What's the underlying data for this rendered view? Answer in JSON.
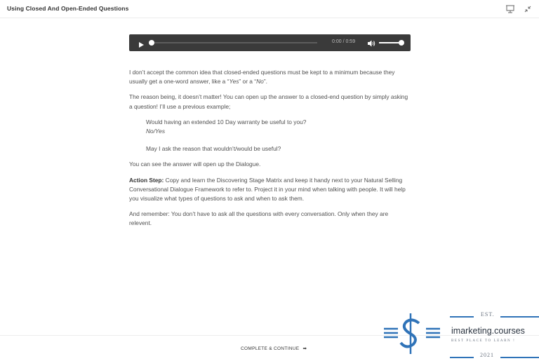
{
  "header": {
    "title": "Using Closed And Open-Ended Questions",
    "icons": [
      "presentation-icon",
      "minimize-icon"
    ]
  },
  "audio_player": {
    "time": "0:00 / 0:59",
    "progress": 0.0,
    "volume": 1.0,
    "icons": [
      "play-icon",
      "volume-icon"
    ]
  },
  "body": {
    "p1": "I don’t accept the common idea that closed-ended questions must be kept to a minimum because they usually get a one-word answer, like a “",
    "p1_yes": "Yes",
    "p1_mid": "” or a “",
    "p1_no": "No",
    "p1_end": "”.",
    "p2": "The reason being, it doesn’t matter! You can open up the answer to a closed-end question by simply asking a question! I’ll use a previous example;",
    "question": "Would having an extended 10 Day warranty be useful to you?",
    "answer": "No/Yes",
    "followup": "May I ask the reason that wouldn’t/would be useful?",
    "p3": "You can see the answer will open up the Dialogue.",
    "action_label": "Action Step:",
    "action_text": " Copy and learn the Discovering Stage Matrix and keep it handy next to your Natural Selling Conversational Dialogue Framework to refer to. Project it in your mind when talking with people. It will help you visualize what types of questions to ask and when to ask them.",
    "p5": "And remember: You don’t have to ask all the questions with every conversation. Only when they are relevent."
  },
  "footer": {
    "complete_label": "COMPLETE & CONTINUE",
    "arrow": "➡"
  },
  "watermark": {
    "est": "EST.",
    "brand": "imarketing.courses",
    "tagline": "BEST PLACE TO LEARN !",
    "year": "2021",
    "color": "#2f73b8"
  }
}
